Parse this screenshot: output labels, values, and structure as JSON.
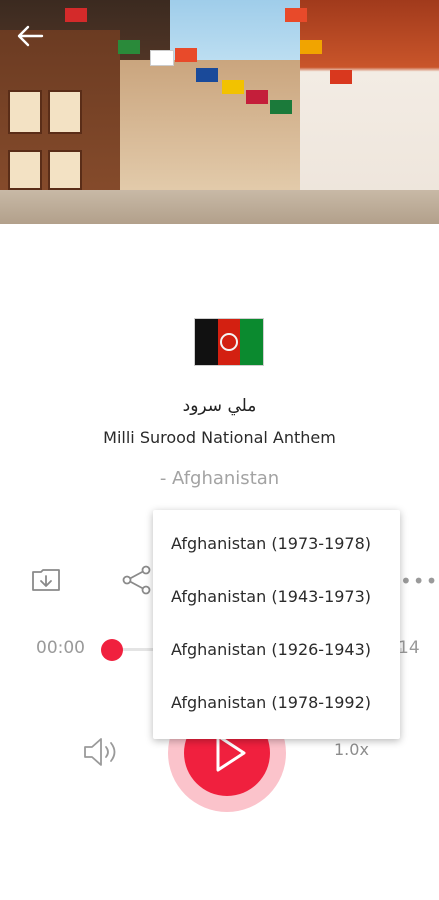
{
  "header": {
    "back_icon": "arrow-left-icon"
  },
  "anthem": {
    "title_native": "ملي سرود",
    "title": "Milli Surood National Anthem",
    "country": "- Afghanistan",
    "flag_colors": [
      "#111111",
      "#d32011",
      "#0b8a2f"
    ]
  },
  "actions": {
    "download_icon": "download-icon",
    "share_icon": "share-icon",
    "more_icon": "more-icon"
  },
  "player": {
    "elapsed": "00:00",
    "duration_partial": "14",
    "progress": 0,
    "volume_icon": "volume-icon",
    "play_icon": "play-icon",
    "speed": "1.0x",
    "accent": "#f0203e"
  },
  "version_menu": {
    "items": [
      "Afghanistan (1973-1978)",
      "Afghanistan (1943-1973)",
      "Afghanistan (1926-1943)",
      "Afghanistan (1978-1992)"
    ]
  }
}
